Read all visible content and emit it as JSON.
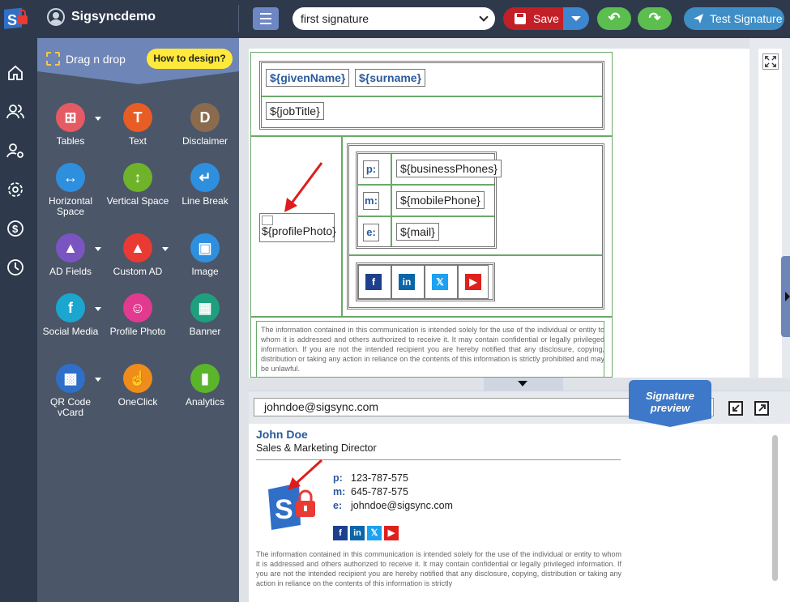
{
  "header": {
    "account_name": "Sigsyncdemo",
    "signature_name": "first signature",
    "save_label": "Save",
    "test_label": "Test Signature"
  },
  "palette": {
    "title": "Drag n drop",
    "how_label": "How to design?",
    "tools": [
      {
        "label": "Tables",
        "color": "#e65a64",
        "glyph": "⊞",
        "dropdown": true
      },
      {
        "label": "Text",
        "color": "#e85d24",
        "glyph": "T",
        "dropdown": false
      },
      {
        "label": "Disclaimer",
        "color": "#8a6b4e",
        "glyph": "D",
        "dropdown": false
      },
      {
        "label": "Horizontal Space",
        "color": "#2f8fdf",
        "glyph": "↔",
        "dropdown": false
      },
      {
        "label": "Vertical Space",
        "color": "#6fb32a",
        "glyph": "↕",
        "dropdown": false
      },
      {
        "label": "Line Break",
        "color": "#2f8fdf",
        "glyph": "↵",
        "dropdown": false
      },
      {
        "label": "AD Fields",
        "color": "#7a55c2",
        "glyph": "▲",
        "dropdown": true
      },
      {
        "label": "Custom AD",
        "color": "#e93a33",
        "glyph": "▲",
        "dropdown": true
      },
      {
        "label": "Image",
        "color": "#2f8fdf",
        "glyph": "▣",
        "dropdown": false
      },
      {
        "label": "Social Media",
        "color": "#1aa6cf",
        "glyph": "f",
        "dropdown": true
      },
      {
        "label": "Profile Photo",
        "color": "#e23a8f",
        "glyph": "☺",
        "dropdown": false
      },
      {
        "label": "Banner",
        "color": "#1e9f7d",
        "glyph": "▦",
        "dropdown": false
      },
      {
        "label": "QR Code vCard",
        "color": "#2f6fc8",
        "glyph": "▩",
        "dropdown": true
      },
      {
        "label": "OneClick",
        "color": "#ef8c1a",
        "glyph": "☝",
        "dropdown": false
      },
      {
        "label": "Analytics",
        "color": "#5bb52a",
        "glyph": "▮",
        "dropdown": false
      }
    ]
  },
  "editor": {
    "given": "${givenName}",
    "surname": "${surname}",
    "jobtitle": "${jobTitle}",
    "photo": "${profilePhoto}",
    "p": "p:",
    "m": "m:",
    "e": "e:",
    "phone": "${businessPhones}",
    "mobile": "${mobilePhone}",
    "mail": "${mail}",
    "social": [
      {
        "g": "f",
        "c": "#1d3f8e"
      },
      {
        "g": "in",
        "c": "#0a66a8"
      },
      {
        "g": "𝕏",
        "c": "#1da1f2"
      },
      {
        "g": "▶",
        "c": "#e0201b"
      }
    ],
    "disclaimer": "The information contained in this communication is intended solely for the use of the individual or entity to whom it is addressed and others authorized to receive it. It may contain confidential or legally privileged information. If you are not the intended recipient you are hereby notified that any disclosure, copying, distribution or taking any action in reliance on the contents of this information is strictly prohibited and may be unlawful."
  },
  "preview": {
    "email": "johndoe@sigsync.com",
    "ribbon": "Signature preview",
    "name": "John Doe",
    "title": "Sales & Marketing Director",
    "p_label": "p:",
    "m_label": "m:",
    "e_label": "e:",
    "phone": "123-787-575",
    "mobile": "645-787-575",
    "mail": "johndoe@sigsync.com",
    "disclaimer": "The information contained in this communication is intended solely for the use of the individual or entity to whom it is addressed and others authorized to receive it. It may contain confidential or legally privileged information. If you are not the intended recipient you are hereby notified that any disclosure, copying, distribution or taking any action in reliance on the contents of this information is strictly"
  },
  "colors": {
    "topbar": "#2e3a4c",
    "accent": "#6e85b7",
    "save": "#c21f27",
    "green": "#5bbe4f",
    "link": "#2a5a9c"
  }
}
